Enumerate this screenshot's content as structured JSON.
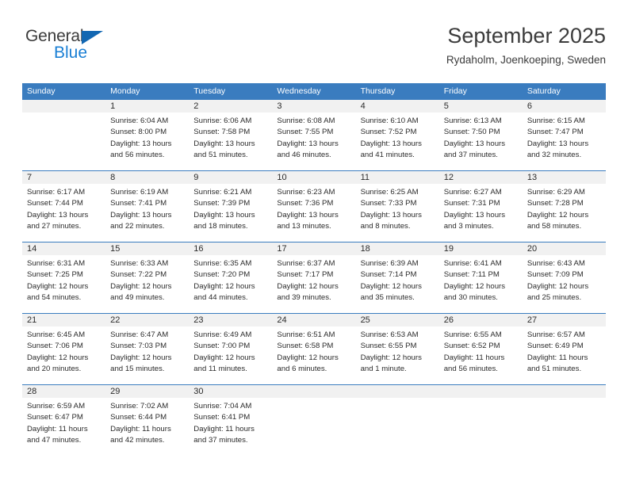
{
  "brand": {
    "name_top": "General",
    "name_bottom": "Blue",
    "color_blue": "#1a7fd4",
    "color_dark": "#3c3c3c"
  },
  "header": {
    "title": "September 2025",
    "subtitle": "Rydaholm, Joenkoeping, Sweden"
  },
  "theme": {
    "header_bg": "#3a7cbf",
    "header_text": "#ffffff",
    "daynum_bg": "#f1f1f1",
    "text": "#2b2b2b"
  },
  "weekdays": [
    "Sunday",
    "Monday",
    "Tuesday",
    "Wednesday",
    "Thursday",
    "Friday",
    "Saturday"
  ],
  "weeks": [
    [
      {
        "day": "",
        "sunrise": "",
        "sunset": "",
        "daylight1": "",
        "daylight2": ""
      },
      {
        "day": "1",
        "sunrise": "Sunrise: 6:04 AM",
        "sunset": "Sunset: 8:00 PM",
        "daylight1": "Daylight: 13 hours",
        "daylight2": "and 56 minutes."
      },
      {
        "day": "2",
        "sunrise": "Sunrise: 6:06 AM",
        "sunset": "Sunset: 7:58 PM",
        "daylight1": "Daylight: 13 hours",
        "daylight2": "and 51 minutes."
      },
      {
        "day": "3",
        "sunrise": "Sunrise: 6:08 AM",
        "sunset": "Sunset: 7:55 PM",
        "daylight1": "Daylight: 13 hours",
        "daylight2": "and 46 minutes."
      },
      {
        "day": "4",
        "sunrise": "Sunrise: 6:10 AM",
        "sunset": "Sunset: 7:52 PM",
        "daylight1": "Daylight: 13 hours",
        "daylight2": "and 41 minutes."
      },
      {
        "day": "5",
        "sunrise": "Sunrise: 6:13 AM",
        "sunset": "Sunset: 7:50 PM",
        "daylight1": "Daylight: 13 hours",
        "daylight2": "and 37 minutes."
      },
      {
        "day": "6",
        "sunrise": "Sunrise: 6:15 AM",
        "sunset": "Sunset: 7:47 PM",
        "daylight1": "Daylight: 13 hours",
        "daylight2": "and 32 minutes."
      }
    ],
    [
      {
        "day": "7",
        "sunrise": "Sunrise: 6:17 AM",
        "sunset": "Sunset: 7:44 PM",
        "daylight1": "Daylight: 13 hours",
        "daylight2": "and 27 minutes."
      },
      {
        "day": "8",
        "sunrise": "Sunrise: 6:19 AM",
        "sunset": "Sunset: 7:41 PM",
        "daylight1": "Daylight: 13 hours",
        "daylight2": "and 22 minutes."
      },
      {
        "day": "9",
        "sunrise": "Sunrise: 6:21 AM",
        "sunset": "Sunset: 7:39 PM",
        "daylight1": "Daylight: 13 hours",
        "daylight2": "and 18 minutes."
      },
      {
        "day": "10",
        "sunrise": "Sunrise: 6:23 AM",
        "sunset": "Sunset: 7:36 PM",
        "daylight1": "Daylight: 13 hours",
        "daylight2": "and 13 minutes."
      },
      {
        "day": "11",
        "sunrise": "Sunrise: 6:25 AM",
        "sunset": "Sunset: 7:33 PM",
        "daylight1": "Daylight: 13 hours",
        "daylight2": "and 8 minutes."
      },
      {
        "day": "12",
        "sunrise": "Sunrise: 6:27 AM",
        "sunset": "Sunset: 7:31 PM",
        "daylight1": "Daylight: 13 hours",
        "daylight2": "and 3 minutes."
      },
      {
        "day": "13",
        "sunrise": "Sunrise: 6:29 AM",
        "sunset": "Sunset: 7:28 PM",
        "daylight1": "Daylight: 12 hours",
        "daylight2": "and 58 minutes."
      }
    ],
    [
      {
        "day": "14",
        "sunrise": "Sunrise: 6:31 AM",
        "sunset": "Sunset: 7:25 PM",
        "daylight1": "Daylight: 12 hours",
        "daylight2": "and 54 minutes."
      },
      {
        "day": "15",
        "sunrise": "Sunrise: 6:33 AM",
        "sunset": "Sunset: 7:22 PM",
        "daylight1": "Daylight: 12 hours",
        "daylight2": "and 49 minutes."
      },
      {
        "day": "16",
        "sunrise": "Sunrise: 6:35 AM",
        "sunset": "Sunset: 7:20 PM",
        "daylight1": "Daylight: 12 hours",
        "daylight2": "and 44 minutes."
      },
      {
        "day": "17",
        "sunrise": "Sunrise: 6:37 AM",
        "sunset": "Sunset: 7:17 PM",
        "daylight1": "Daylight: 12 hours",
        "daylight2": "and 39 minutes."
      },
      {
        "day": "18",
        "sunrise": "Sunrise: 6:39 AM",
        "sunset": "Sunset: 7:14 PM",
        "daylight1": "Daylight: 12 hours",
        "daylight2": "and 35 minutes."
      },
      {
        "day": "19",
        "sunrise": "Sunrise: 6:41 AM",
        "sunset": "Sunset: 7:11 PM",
        "daylight1": "Daylight: 12 hours",
        "daylight2": "and 30 minutes."
      },
      {
        "day": "20",
        "sunrise": "Sunrise: 6:43 AM",
        "sunset": "Sunset: 7:09 PM",
        "daylight1": "Daylight: 12 hours",
        "daylight2": "and 25 minutes."
      }
    ],
    [
      {
        "day": "21",
        "sunrise": "Sunrise: 6:45 AM",
        "sunset": "Sunset: 7:06 PM",
        "daylight1": "Daylight: 12 hours",
        "daylight2": "and 20 minutes."
      },
      {
        "day": "22",
        "sunrise": "Sunrise: 6:47 AM",
        "sunset": "Sunset: 7:03 PM",
        "daylight1": "Daylight: 12 hours",
        "daylight2": "and 15 minutes."
      },
      {
        "day": "23",
        "sunrise": "Sunrise: 6:49 AM",
        "sunset": "Sunset: 7:00 PM",
        "daylight1": "Daylight: 12 hours",
        "daylight2": "and 11 minutes."
      },
      {
        "day": "24",
        "sunrise": "Sunrise: 6:51 AM",
        "sunset": "Sunset: 6:58 PM",
        "daylight1": "Daylight: 12 hours",
        "daylight2": "and 6 minutes."
      },
      {
        "day": "25",
        "sunrise": "Sunrise: 6:53 AM",
        "sunset": "Sunset: 6:55 PM",
        "daylight1": "Daylight: 12 hours",
        "daylight2": "and 1 minute."
      },
      {
        "day": "26",
        "sunrise": "Sunrise: 6:55 AM",
        "sunset": "Sunset: 6:52 PM",
        "daylight1": "Daylight: 11 hours",
        "daylight2": "and 56 minutes."
      },
      {
        "day": "27",
        "sunrise": "Sunrise: 6:57 AM",
        "sunset": "Sunset: 6:49 PM",
        "daylight1": "Daylight: 11 hours",
        "daylight2": "and 51 minutes."
      }
    ],
    [
      {
        "day": "28",
        "sunrise": "Sunrise: 6:59 AM",
        "sunset": "Sunset: 6:47 PM",
        "daylight1": "Daylight: 11 hours",
        "daylight2": "and 47 minutes."
      },
      {
        "day": "29",
        "sunrise": "Sunrise: 7:02 AM",
        "sunset": "Sunset: 6:44 PM",
        "daylight1": "Daylight: 11 hours",
        "daylight2": "and 42 minutes."
      },
      {
        "day": "30",
        "sunrise": "Sunrise: 7:04 AM",
        "sunset": "Sunset: 6:41 PM",
        "daylight1": "Daylight: 11 hours",
        "daylight2": "and 37 minutes."
      },
      {
        "day": "",
        "sunrise": "",
        "sunset": "",
        "daylight1": "",
        "daylight2": ""
      },
      {
        "day": "",
        "sunrise": "",
        "sunset": "",
        "daylight1": "",
        "daylight2": ""
      },
      {
        "day": "",
        "sunrise": "",
        "sunset": "",
        "daylight1": "",
        "daylight2": ""
      },
      {
        "day": "",
        "sunrise": "",
        "sunset": "",
        "daylight1": "",
        "daylight2": ""
      }
    ]
  ]
}
